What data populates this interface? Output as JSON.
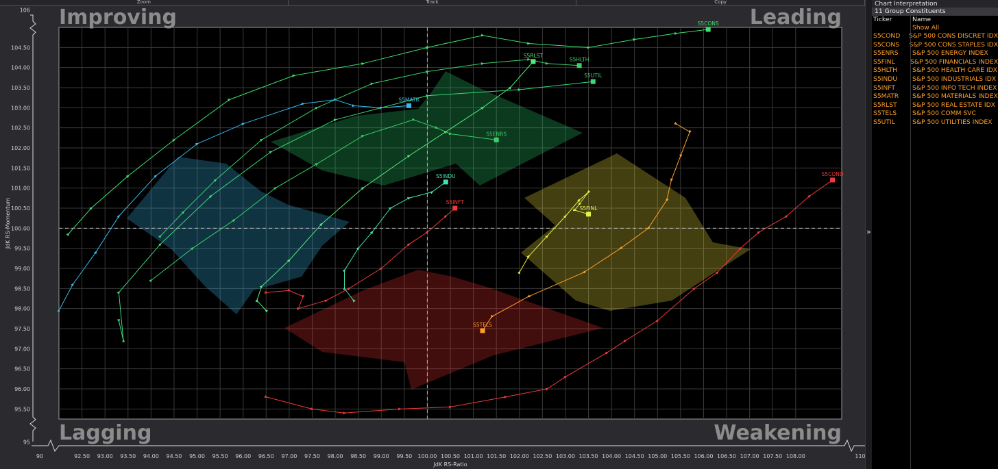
{
  "toolbar": {
    "zoom": "Zoom",
    "track": "Track",
    "copy": "Copy"
  },
  "side_panel": {
    "title": "Chart Interpretation",
    "count": "11 Group Constituents",
    "col_ticker": "Ticker",
    "col_name": "Name",
    "show_all": "Show All",
    "rows": [
      {
        "ticker": "S5COND",
        "name": "S&P 500 CONS DISCRET IDX"
      },
      {
        "ticker": "S5CONS",
        "name": "S&P 500 CONS STAPLES IDX"
      },
      {
        "ticker": "S5ENRS",
        "name": "S&P 500 ENERGY INDEX"
      },
      {
        "ticker": "S5FINL",
        "name": "S&P 500 FINANCIALS INDEX"
      },
      {
        "ticker": "S5HLTH",
        "name": "S&P 500 HEALTH CARE IDX"
      },
      {
        "ticker": "S5INDU",
        "name": "S&P 500 INDUSTRIALS IDX"
      },
      {
        "ticker": "S5INFT",
        "name": "S&P 500 INFO TECH INDEX"
      },
      {
        "ticker": "S5MATR",
        "name": "S&P 500 MATERIALS INDEX"
      },
      {
        "ticker": "S5RLST",
        "name": "S&P 500 REAL ESTATE IDX"
      },
      {
        "ticker": "S5TELS",
        "name": "S&P 500 COMM SVC"
      },
      {
        "ticker": "S5UTIL",
        "name": "S&P 500 UTILITIES INDEX"
      }
    ]
  },
  "chart_data": {
    "type": "scatter",
    "title": "",
    "xlabel": "JdK RS-Ratio",
    "ylabel": "JdK RS-Momentum",
    "xlim": [
      92.0,
      109.0
    ],
    "ylim": [
      95.25,
      105.0
    ],
    "outer_x_labels": [
      "90",
      "110"
    ],
    "outer_y_labels": [
      "106",
      "95"
    ],
    "x_ticks": [
      "92.50",
      "93.00",
      "93.50",
      "94.00",
      "94.50",
      "95.00",
      "95.50",
      "96.00",
      "96.50",
      "97.00",
      "97.50",
      "98.00",
      "98.50",
      "99.00",
      "99.50",
      "100.00",
      "100.50",
      "101.00",
      "101.50",
      "102.00",
      "102.50",
      "103.00",
      "103.50",
      "104.00",
      "104.50",
      "105.00",
      "105.50",
      "106.00",
      "106.50",
      "107.00",
      "107.50",
      "108.00"
    ],
    "y_ticks": [
      "95.50",
      "96.00",
      "96.50",
      "97.00",
      "97.50",
      "98.00",
      "98.50",
      "99.00",
      "99.50",
      "100.00",
      "100.50",
      "101.00",
      "101.50",
      "102.00",
      "102.50",
      "103.00",
      "103.50",
      "104.00",
      "104.50"
    ],
    "center": [
      100,
      100
    ],
    "quadrants": {
      "improving": "Improving",
      "leading": "Leading",
      "lagging": "Lagging",
      "weakening": "Weakening"
    },
    "colors": {
      "leading": "#2bd06a",
      "improving": "#3ab6ea",
      "lagging": "#ee3030",
      "weakening": "#f0e43a",
      "background": "#000000"
    },
    "series": [
      {
        "name": "S5COND",
        "color": "#ee3a3a",
        "points": [
          [
            96.5,
            95.8
          ],
          [
            97.5,
            95.5
          ],
          [
            98.2,
            95.4
          ],
          [
            99.4,
            95.5
          ],
          [
            100.5,
            95.55
          ],
          [
            101.7,
            95.8
          ],
          [
            102.6,
            96.0
          ],
          [
            103.0,
            96.3
          ],
          [
            103.9,
            96.9
          ],
          [
            104.3,
            97.2
          ],
          [
            105.0,
            97.7
          ],
          [
            105.8,
            98.5
          ],
          [
            106.3,
            98.9
          ],
          [
            106.8,
            99.5
          ],
          [
            107.2,
            99.9
          ],
          [
            107.8,
            100.3
          ],
          [
            108.3,
            100.8
          ],
          [
            108.8,
            101.2
          ]
        ]
      },
      {
        "name": "S5CONS",
        "color": "#3ee06e",
        "points": [
          [
            92.2,
            99.85
          ],
          [
            92.7,
            100.5
          ],
          [
            93.5,
            101.3
          ],
          [
            94.5,
            102.2
          ],
          [
            95.7,
            103.2
          ],
          [
            97.1,
            103.8
          ],
          [
            98.6,
            104.1
          ],
          [
            100.0,
            104.5
          ],
          [
            101.2,
            104.8
          ],
          [
            102.2,
            104.6
          ],
          [
            103.5,
            104.5
          ],
          [
            104.5,
            104.7
          ],
          [
            105.4,
            104.85
          ],
          [
            106.1,
            104.95
          ]
        ]
      },
      {
        "name": "S5ENRS",
        "color": "#38cf6a",
        "points": [
          [
            94.0,
            98.7
          ],
          [
            94.9,
            99.5
          ],
          [
            95.8,
            100.2
          ],
          [
            96.7,
            101.0
          ],
          [
            97.6,
            101.6
          ],
          [
            98.6,
            102.3
          ],
          [
            99.7,
            102.7
          ],
          [
            100.2,
            102.5
          ],
          [
            100.5,
            102.35
          ],
          [
            101.5,
            102.2
          ]
        ]
      },
      {
        "name": "S5FINL",
        "color": "#e8f04a",
        "points": [
          [
            102.0,
            98.9
          ],
          [
            102.2,
            99.3
          ],
          [
            102.6,
            99.8
          ],
          [
            103.0,
            100.3
          ],
          [
            103.3,
            100.7
          ],
          [
            103.5,
            100.9
          ],
          [
            103.3,
            100.6
          ],
          [
            103.2,
            100.45
          ],
          [
            103.5,
            100.35
          ]
        ]
      },
      {
        "name": "S5HLTH",
        "color": "#3ad06a",
        "points": [
          [
            94.2,
            99.8
          ],
          [
            94.7,
            100.4
          ],
          [
            95.4,
            101.2
          ],
          [
            96.4,
            102.2
          ],
          [
            97.6,
            103.0
          ],
          [
            98.8,
            103.6
          ],
          [
            100.0,
            103.9
          ],
          [
            101.2,
            104.1
          ],
          [
            102.2,
            104.2
          ],
          [
            102.6,
            104.1
          ],
          [
            103.3,
            104.05
          ]
        ]
      },
      {
        "name": "S5INDU",
        "color": "#44e2ae",
        "points": [
          [
            98.4,
            98.2
          ],
          [
            98.2,
            98.5
          ],
          [
            98.2,
            98.95
          ],
          [
            98.5,
            99.5
          ],
          [
            98.8,
            99.9
          ],
          [
            99.2,
            100.5
          ],
          [
            99.6,
            100.75
          ],
          [
            100.1,
            100.9
          ],
          [
            100.4,
            101.15
          ]
        ]
      },
      {
        "name": "S5INFT",
        "color": "#ee3a3a",
        "points": [
          [
            96.5,
            98.4
          ],
          [
            97.0,
            98.45
          ],
          [
            97.3,
            98.3
          ],
          [
            97.2,
            98.0
          ],
          [
            97.8,
            98.2
          ],
          [
            98.3,
            98.5
          ],
          [
            99.0,
            99.0
          ],
          [
            99.6,
            99.6
          ],
          [
            100.0,
            99.9
          ],
          [
            100.4,
            100.3
          ],
          [
            100.6,
            100.5
          ]
        ]
      },
      {
        "name": "S5MATR",
        "color": "#3ab8ea",
        "points": [
          [
            92.0,
            97.95
          ],
          [
            92.3,
            98.6
          ],
          [
            92.8,
            99.4
          ],
          [
            93.3,
            100.3
          ],
          [
            94.1,
            101.3
          ],
          [
            95.0,
            102.1
          ],
          [
            96.0,
            102.6
          ],
          [
            97.3,
            103.1
          ],
          [
            98.0,
            103.2
          ],
          [
            98.4,
            103.05
          ],
          [
            99.0,
            103.0
          ],
          [
            99.6,
            103.05
          ]
        ]
      },
      {
        "name": "S5RLST",
        "color": "#55e87a",
        "points": [
          [
            96.5,
            97.95
          ],
          [
            96.3,
            98.2
          ],
          [
            96.4,
            98.55
          ],
          [
            97.0,
            99.2
          ],
          [
            97.7,
            100.1
          ],
          [
            98.6,
            101.0
          ],
          [
            99.6,
            101.8
          ],
          [
            100.4,
            102.4
          ],
          [
            101.2,
            103.0
          ],
          [
            101.8,
            103.5
          ],
          [
            102.3,
            104.15
          ]
        ]
      },
      {
        "name": "S5TELS",
        "color": "#ff9f2a",
        "points": [
          [
            105.4,
            102.6
          ],
          [
            105.7,
            102.4
          ],
          [
            105.5,
            101.8
          ],
          [
            105.3,
            101.2
          ],
          [
            105.2,
            100.7
          ],
          [
            104.8,
            100.0
          ],
          [
            104.2,
            99.5
          ],
          [
            103.4,
            98.9
          ],
          [
            102.2,
            98.3
          ],
          [
            101.4,
            97.8
          ],
          [
            101.2,
            97.45
          ]
        ]
      },
      {
        "name": "S5UTIL",
        "color": "#3dd878",
        "points": [
          [
            93.3,
            97.7
          ],
          [
            93.4,
            97.2
          ],
          [
            93.3,
            98.4
          ],
          [
            94.2,
            99.6
          ],
          [
            95.3,
            100.8
          ],
          [
            96.6,
            101.9
          ],
          [
            98.0,
            102.7
          ],
          [
            100.0,
            103.3
          ],
          [
            102.0,
            103.45
          ],
          [
            103.6,
            103.65
          ]
        ]
      }
    ]
  }
}
